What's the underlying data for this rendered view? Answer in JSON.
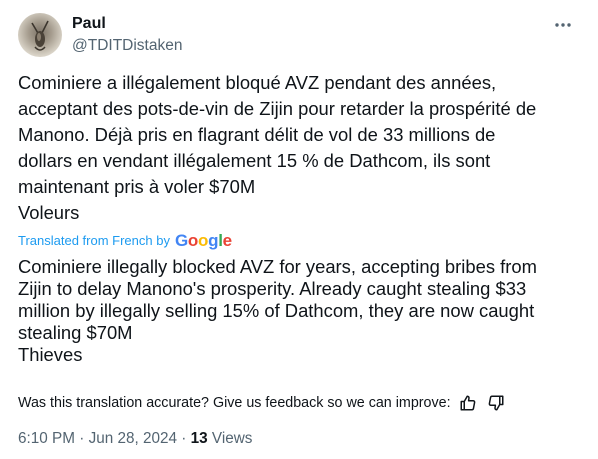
{
  "author": {
    "name": "Paul",
    "handle": "@TDITDistaken"
  },
  "post": {
    "original_lines": [
      "Cominiere a illégalement bloqué AVZ pendant des années,",
      "acceptant des pots-de-vin de Zijin pour retarder la prospérité de",
      "Manono. Déjà pris en flagrant délit de vol de 33 millions de",
      "dollars en vendant illégalement 15 % de Dathcom, ils sont",
      "maintenant pris à voler $70M",
      "Voleurs"
    ],
    "translated_from": "Translated from French by",
    "translator_brand": "Google",
    "translation_lines": [
      "Cominiere illegally blocked AVZ for years, accepting bribes from",
      "Zijin to delay Manono's prosperity. Already caught stealing $33",
      "million by illegally selling 15% of Dathcom, they are now caught",
      "stealing $70M",
      "Thieves"
    ]
  },
  "feedback": {
    "question": "Was this translation accurate? Give us feedback so we can improve:"
  },
  "meta": {
    "time": "6:10 PM",
    "separator": "·",
    "date": "Jun 28, 2024",
    "views_count": "13",
    "views_label": "Views"
  },
  "colors": {
    "link": "#1d9bf0",
    "secondary": "#536471",
    "text": "#0f1419"
  },
  "icons": {
    "more": "more-dots-icon",
    "thumbs_up": "thumbs-up-icon",
    "thumbs_down": "thumbs-down-icon"
  }
}
